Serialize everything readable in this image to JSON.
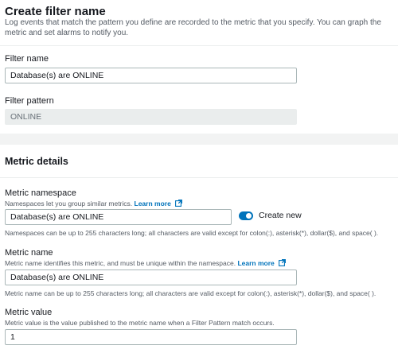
{
  "filter_section": {
    "title": "Create filter name",
    "description": "Log events that match the pattern you define are recorded to the metric that you specify. You can graph the metric and set alarms to notify you.",
    "filter_name_label": "Filter name",
    "filter_name_value": "Database(s) are ONLINE",
    "filter_pattern_label": "Filter pattern",
    "filter_pattern_value": "ONLINE"
  },
  "metric_section": {
    "title": "Metric details",
    "namespace_label": "Metric namespace",
    "namespace_help": "Namespaces let you group similar metrics.",
    "namespace_learn_more": "Learn more",
    "namespace_value": "Database(s) are ONLINE",
    "create_new_label": "Create new",
    "create_new_enabled": true,
    "namespace_constraint": "Namespaces can be up to 255 characters long; all characters are valid except for colon(:), asterisk(*), dollar($), and space( ).",
    "metric_name_label": "Metric name",
    "metric_name_help": "Metric name identifies this metric, and must be unique within the namespace.",
    "metric_name_learn_more": "Learn more",
    "metric_name_value": "Database(s) are ONLINE",
    "metric_name_constraint": "Metric name can be up to 255 characters long; all characters are valid except for colon(:), asterisk(*), dollar($), and space( ).",
    "metric_value_label": "Metric value",
    "metric_value_help": "Metric value is the value published to the metric name when a Filter Pattern match occurs.",
    "metric_value_value": "1"
  },
  "colors": {
    "link": "#0073bb",
    "toggle_on": "#0073bb",
    "page_background": "#f2f3f3"
  }
}
